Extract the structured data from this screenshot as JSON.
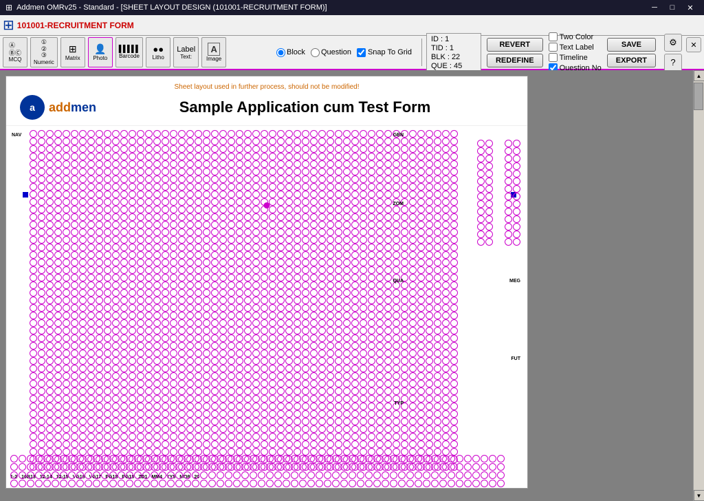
{
  "titlebar": {
    "title": "Addmen OMRv25 - Standard - [SHEET LAYOUT DESIGN (101001-RECRUITMENT FORM)]",
    "app_icon": "⊞",
    "min_label": "─",
    "max_label": "□",
    "close_label": "✕"
  },
  "toolbar_top": {
    "app_title": "101001-RECRUITMENT FORM"
  },
  "toolbar2": {
    "radio_block": "Block",
    "radio_question": "Question",
    "snap_label": "Snap To Grid",
    "id_label": "ID : 1",
    "tid_label": "TID : 1",
    "blk_label": "BLK : 22",
    "que_label": "QUE : 45",
    "revert_label": "REVERT",
    "redefine_label": "REDEFINE",
    "save_label": "SAVE",
    "export_label": "EXPORT",
    "check_two_color": "Two Color",
    "check_text_label": "Text Label",
    "check_timeline": "Timeline",
    "check_question_no": "Question No",
    "settings_icon": "⚙",
    "help_icon": "?",
    "close_icon": "✕"
  },
  "tools": [
    {
      "name": "MCQ",
      "icon": "Ⓐ\nⒷⒸ",
      "label": "MCQ"
    },
    {
      "name": "Numeric",
      "icon": "①\n②\n③",
      "label": "Numeric"
    },
    {
      "name": "Matrix",
      "icon": "◫",
      "label": "Matrix"
    },
    {
      "name": "Photo",
      "icon": "🖼",
      "label": "Photo"
    },
    {
      "name": "Barcode",
      "icon": "▋▋▋",
      "label": "Barcode"
    },
    {
      "name": "Litho",
      "icon": "●●",
      "label": "Litho"
    },
    {
      "name": "Label/Text",
      "icon": "T",
      "label": "Label\nText:"
    },
    {
      "name": "Image",
      "icon": "🔤",
      "label": "Image"
    }
  ],
  "form": {
    "warning": "Sheet layout used in further process, should not be modified!",
    "title": "Sample Application cum Test Form",
    "logo_letter": "a"
  },
  "omr_labels": {
    "nav": "NAV",
    "gen": "GEN",
    "zom": "ZOM",
    "qua": "QUA",
    "meg": "MEG",
    "fut": "FUT",
    "typ": "TYP",
    "bottom_labels": [
      "1-2",
      "10B13",
      "12-14",
      "12-15",
      "VG16",
      "VG17",
      "PG18",
      "PG18",
      "ZD1",
      "MM4",
      "YY5",
      "MO8",
      "20"
    ]
  },
  "anchor": {
    "top_center": "top-center-anchor"
  }
}
